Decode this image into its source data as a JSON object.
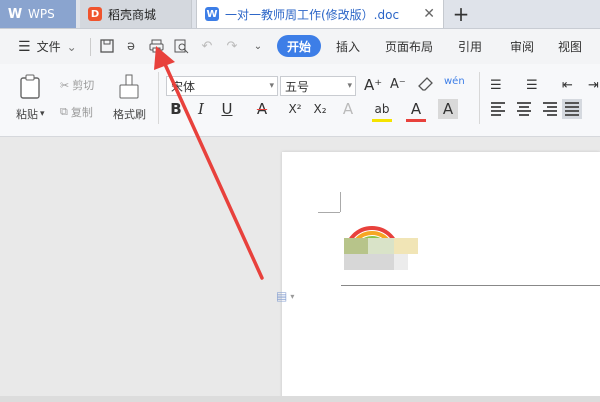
{
  "tabs": {
    "wps": {
      "label": "WPS"
    },
    "daoke": {
      "label": "稻壳商城"
    },
    "doc": {
      "label": "一对一教师周工作(修改版）.doc"
    }
  },
  "new_tab_symbol": "+",
  "menu": {
    "file_label": "文件",
    "start_label": "开始",
    "insert_label": "插入",
    "layout_label": "页面布局",
    "reference_label": "引用",
    "review_label": "审阅",
    "view_label": "视图"
  },
  "ribbon": {
    "paste_label": "粘贴",
    "cut_label": "剪切",
    "copy_label": "复制",
    "format_painter_label": "格式刷",
    "font_name": "宋体",
    "font_size": "五号",
    "bold": "B",
    "italic": "I",
    "underline": "U",
    "strike": "A",
    "superscript": "X²",
    "subscript": "X₂",
    "font_color": "A",
    "char_shading": "A",
    "grow": "A⁺",
    "shrink": "A⁻",
    "phonetic": "wén",
    "highlight": "ab"
  },
  "colors": {
    "accent": "#3d7ee7",
    "arrow": "#e8413c",
    "wps_tab": "#8aa4cf",
    "daoke_icon": "#f0542d"
  },
  "icons": [
    "hamburger-icon",
    "save-icon",
    "undo-like-icon",
    "print-icon",
    "print-preview-icon",
    "undo-icon",
    "redo-icon",
    "dropdown-icon",
    "paste-icon",
    "scissors-icon",
    "copy-icon",
    "brush-icon",
    "eraser-icon",
    "bullet-list-icon",
    "numbered-list-icon",
    "indent-icon",
    "align-icon",
    "rainbow-icon",
    "document-icon"
  ]
}
